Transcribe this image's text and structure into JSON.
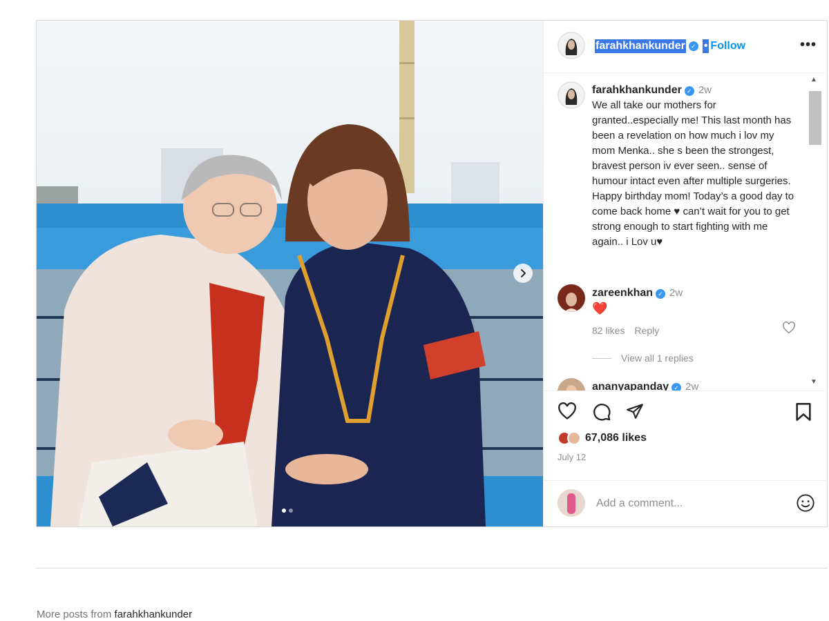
{
  "post": {
    "username": "farahkhankunder",
    "follow_label": "Follow",
    "separator": "•",
    "more_label": "•••",
    "caption": {
      "username": "farahkhankunder",
      "time": "2w",
      "text": "We all take our mothers for granted..especially me! This last month has been a revelation on how much i lov my mom Menka.. she s been the strongest, bravest person iv ever seen.. sense of humour intact even after multiple surgeries.\nHappy birthday mom! Today’s a good day to come back home ♥ can’t wait for you to get strong enough to start fighting with me again.. i Lov u♥"
    },
    "comments": [
      {
        "username": "zareenkhan",
        "time": "2w",
        "text": "❤️",
        "likes": "82 likes",
        "reply_label": "Reply",
        "view_replies": "View all 1 replies"
      },
      {
        "username": "ananyapanday",
        "time": "2w"
      }
    ],
    "likes_count": "67,086 likes",
    "date": "July 12",
    "add_comment_placeholder": "Add a comment..."
  },
  "footer": {
    "more_posts_prefix": "More posts from",
    "more_posts_user": "farahkhankunder"
  },
  "colors": {
    "accent": "#0095f6",
    "verified": "#3897f0",
    "selection": "#3a78e8",
    "heart": "#ed4956"
  },
  "icons": [
    "heart-icon",
    "comment-icon",
    "share-icon",
    "bookmark-icon",
    "emoji-icon",
    "chevron-right-icon",
    "verified-icon"
  ]
}
